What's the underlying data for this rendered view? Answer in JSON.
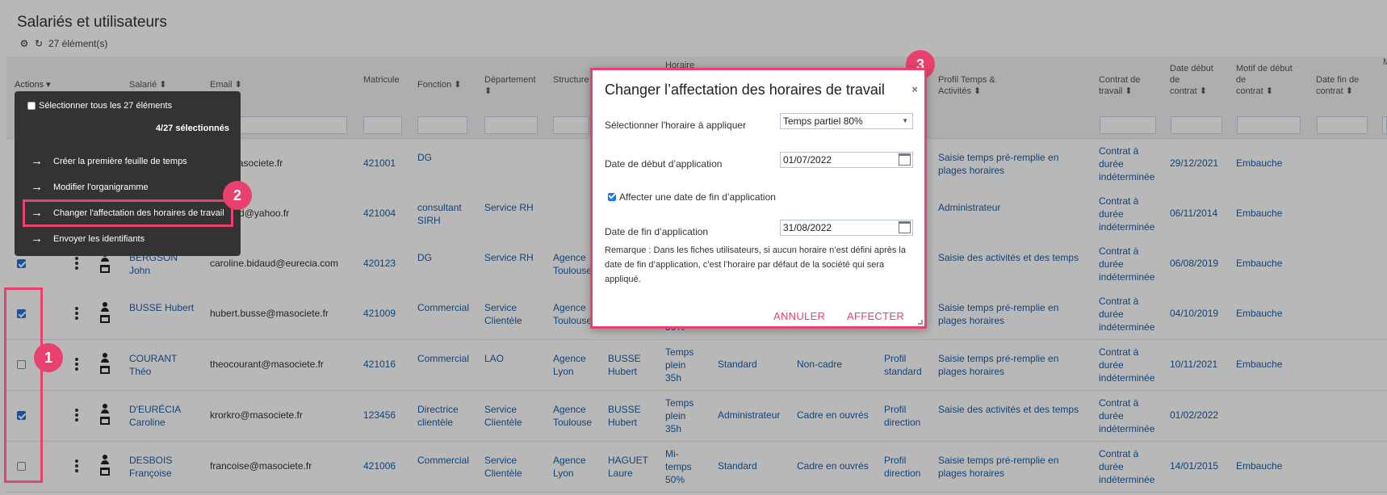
{
  "page": {
    "title": "Salariés et utilisateurs",
    "count": "27 élément(s)"
  },
  "columns": {
    "actions": "Actions",
    "salarie": "Salarié",
    "email": "Email",
    "matricule": "Matricule",
    "fonction": "Fonction",
    "departement": "Département",
    "structure": "Structure",
    "horaire": "Horaire",
    "profil_temps_1": "Profil Temps &",
    "profil_temps_2": "Activités",
    "contrat_1": "Contrat de",
    "contrat_2": "travail",
    "date_debut_1": "Date début",
    "date_debut_2": "de",
    "date_debut_3": "contrat",
    "motif_1": "Motif de début",
    "motif_2": "de",
    "motif_3": "contrat",
    "date_fin_1": "Date fin de",
    "date_fin_2": "contrat",
    "last_col": "M"
  },
  "rows": [
    {
      "checked": false,
      "nom_1": "",
      "nom_2": "",
      "email": "iot@masociete.fr",
      "matricule": "421001",
      "fonction_1": "DG",
      "fonction_2": "",
      "departement_1": "",
      "departement_2": "",
      "structure_1": "",
      "structure_2": "",
      "resp_1": "",
      "resp_2": "",
      "horaire_1": "",
      "horaire_2": "",
      "horaire_3": "",
      "profil": "",
      "statut": "",
      "prof_1": "",
      "prof_2": "",
      "profil_temps_1": "Saisie temps pré-remplie en",
      "profil_temps_2": "plages horaires",
      "contrat_1": "Contrat à",
      "contrat_2": "durée",
      "contrat_3": "indéterminée",
      "date_debut": "29/12/2021",
      "motif": "Embauche"
    },
    {
      "checked": false,
      "nom_1": "",
      "nom_2": "",
      "email": "ebidaud@yahoo.fr",
      "matricule": "421004",
      "fonction_1": "consultant",
      "fonction_2": "SIRH",
      "departement_1": "Service RH",
      "departement_2": "",
      "structure_1": "",
      "structure_2": "",
      "resp_1": "",
      "resp_2": "",
      "horaire_1": "",
      "horaire_2": "",
      "horaire_3": "",
      "profil": "",
      "statut": "",
      "prof_1": "",
      "prof_2": "",
      "profil_temps_1": "Administrateur",
      "profil_temps_2": "",
      "contrat_1": "Contrat à",
      "contrat_2": "durée",
      "contrat_3": "indéterminée",
      "date_debut": "06/11/2014",
      "motif": "Embauche"
    },
    {
      "checked": true,
      "nom_1": "BERGSON",
      "nom_2": "John",
      "email": "caroline.bidaud@eurecia.com",
      "matricule": "420123",
      "fonction_1": "DG",
      "fonction_2": "",
      "departement_1": "Service RH",
      "departement_2": "",
      "structure_1": "Agence",
      "structure_2": "Toulouse",
      "resp_1": "",
      "resp_2": "",
      "horaire_1": "",
      "horaire_2": "",
      "horaire_3": "",
      "profil": "",
      "statut": "",
      "prof_1": "",
      "prof_2": "",
      "profil_temps_1": "Saisie des activités et des temps",
      "profil_temps_2": "",
      "contrat_1": "Contrat à",
      "contrat_2": "durée",
      "contrat_3": "indéterminée",
      "date_debut": "06/08/2019",
      "motif": "Embauche"
    },
    {
      "checked": true,
      "nom_1": "BUSSE Hubert",
      "nom_2": "",
      "email": "hubert.busse@masociete.fr",
      "matricule": "421009",
      "fonction_1": "Commercial",
      "fonction_2": "",
      "departement_1": "Service",
      "departement_2": "Clientèle",
      "structure_1": "Agence",
      "structure_2": "Toulouse",
      "resp_1": "",
      "resp_2": "",
      "horaire_1": "",
      "horaire_2": "",
      "horaire_3": "50%",
      "profil": "",
      "statut": "",
      "prof_1": "",
      "prof_2": "",
      "profil_temps_1": "Saisie temps pré-remplie en",
      "profil_temps_2": "plages horaires",
      "contrat_1": "Contrat à",
      "contrat_2": "durée",
      "contrat_3": "indéterminée",
      "date_debut": "04/10/2019",
      "motif": "Embauche"
    },
    {
      "checked": false,
      "nom_1": "COURANT",
      "nom_2": "Théo",
      "email": "theocourant@masociete.fr",
      "matricule": "421016",
      "fonction_1": "Commercial",
      "fonction_2": "",
      "departement_1": "LAO",
      "departement_2": "",
      "structure_1": "Agence",
      "structure_2": "Lyon",
      "resp_1": "BUSSE",
      "resp_2": "Hubert",
      "horaire_1": "Temps",
      "horaire_2": "plein",
      "horaire_3": "35h",
      "profil": "Standard",
      "statut": "Non-cadre",
      "prof_1": "Profil",
      "prof_2": "standard",
      "profil_temps_1": "Saisie temps pré-remplie en",
      "profil_temps_2": "plages horaires",
      "contrat_1": "Contrat à",
      "contrat_2": "durée",
      "contrat_3": "indéterminée",
      "date_debut": "10/11/2021",
      "motif": "Embauche"
    },
    {
      "checked": true,
      "nom_1": "D'EURÉCIA",
      "nom_2": "Caroline",
      "email": "krorkro@masociete.fr",
      "matricule": "123456",
      "fonction_1": "Directrice",
      "fonction_2": "clientèle",
      "departement_1": "Service",
      "departement_2": "Clientèle",
      "structure_1": "Agence",
      "structure_2": "Toulouse",
      "resp_1": "BUSSE",
      "resp_2": "Hubert",
      "horaire_1": "Temps",
      "horaire_2": "plein",
      "horaire_3": "35h",
      "profil": "Administrateur",
      "statut": "Cadre en ouvrés",
      "prof_1": "Profil",
      "prof_2": "direction",
      "profil_temps_1": "Saisie des activités et des temps",
      "profil_temps_2": "",
      "contrat_1": "Contrat à",
      "contrat_2": "durée",
      "contrat_3": "indéterminée",
      "date_debut": "01/02/2022",
      "motif": ""
    },
    {
      "checked": false,
      "nom_1": "DESBOIS",
      "nom_2": "Françoise",
      "email": "francoise@masociete.fr",
      "matricule": "421006",
      "fonction_1": "Commercial",
      "fonction_2": "",
      "departement_1": "Service",
      "departement_2": "Clientèle",
      "structure_1": "Agence",
      "structure_2": "Lyon",
      "resp_1": "HAGUET",
      "resp_2": "Laure",
      "horaire_1": "Mi-",
      "horaire_2": "temps",
      "horaire_3": "50%",
      "profil": "Standard",
      "statut": "Cadre en ouvrés",
      "prof_1": "Profil",
      "prof_2": "direction",
      "profil_temps_1": "Saisie temps pré-remplie en",
      "profil_temps_2": "plages horaires",
      "contrat_1": "Contrat à",
      "contrat_2": "durée",
      "contrat_3": "indéterminée",
      "date_debut": "14/01/2015",
      "motif": "Embauche"
    }
  ],
  "menu": {
    "select_all": "Sélectionner tous les 27 éléments",
    "selected_count": "4/27 sélectionnés",
    "items": [
      "Créer la première feuille de temps",
      "Modifier l'organigramme",
      "Changer l'affectation des horaires de travail",
      "Envoyer les identifiants"
    ]
  },
  "badges": [
    "1",
    "2",
    "3"
  ],
  "modal": {
    "title": "Changer l’affectation des horaires de travail",
    "close": "×",
    "horaire_label": "Sélectionner l'horaire à appliquer",
    "horaire_value": "Temps partiel 80%",
    "date_debut_label": "Date de début d’application",
    "date_debut_value": "01/07/2022",
    "affecter_fin_label": "Affecter une date de fin d’application",
    "date_fin_label": "Date de fin d’application",
    "date_fin_value": "31/08/2022",
    "remark": "Remarque : Dans les fiches utilisateurs, si aucun horaire n’est défini après la date de fin d’application, c’est l’horaire par défaut de la société qui sera appliqué.",
    "cancel": "ANNULER",
    "confirm": "AFFECTER"
  },
  "colors": {
    "accent": "#e8416d",
    "link": "#1b5ea6",
    "menu_bg": "#333333"
  }
}
